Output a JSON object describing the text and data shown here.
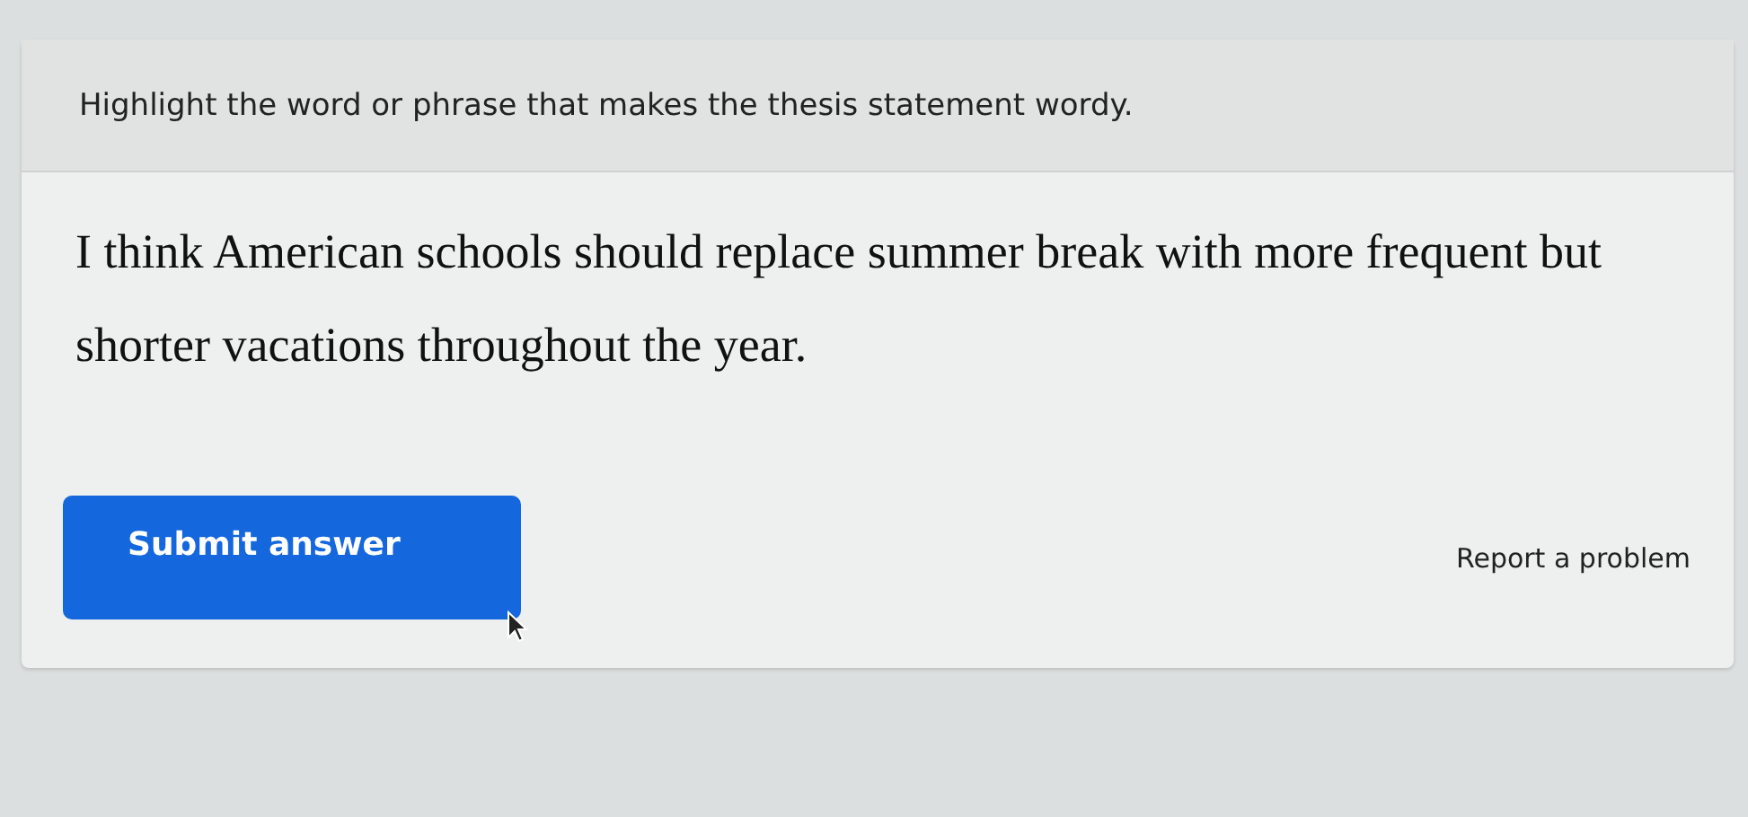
{
  "question": {
    "prompt": "Highlight the word or phrase that makes the thesis statement wordy.",
    "sentence": "I think American schools should replace summer break with more frequent but shorter vacations throughout the year."
  },
  "submit_button": {
    "label": "Submit answer"
  },
  "report_link": {
    "label": "Report a problem"
  }
}
